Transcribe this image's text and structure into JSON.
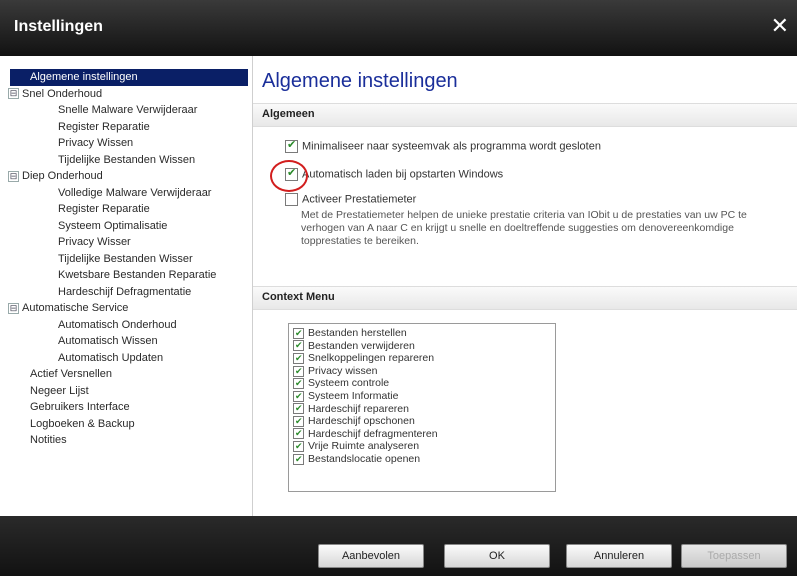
{
  "window": {
    "title": "Instellingen",
    "close_glyph": "✕"
  },
  "sidebar": {
    "items": [
      {
        "label": "Algemene instellingen",
        "level": 1,
        "selected": true
      },
      {
        "label": "Snel Onderhoud",
        "level": 0,
        "expander": "⊟"
      },
      {
        "label": "Snelle Malware Verwijderaar",
        "level": 2
      },
      {
        "label": "Register Reparatie",
        "level": 2
      },
      {
        "label": "Privacy Wissen",
        "level": 2
      },
      {
        "label": "Tijdelijke Bestanden Wissen",
        "level": 2
      },
      {
        "label": "Diep Onderhoud",
        "level": 0,
        "expander": "⊟"
      },
      {
        "label": "Volledige Malware Verwijderaar",
        "level": 2
      },
      {
        "label": "Register Reparatie",
        "level": 2
      },
      {
        "label": "Systeem Optimalisatie",
        "level": 2
      },
      {
        "label": "Privacy Wisser",
        "level": 2
      },
      {
        "label": "Tijdelijke Bestanden Wisser",
        "level": 2
      },
      {
        "label": "Kwetsbare Bestanden Reparatie",
        "level": 2
      },
      {
        "label": "Hardeschijf Defragmentatie",
        "level": 2
      },
      {
        "label": "Automatische Service",
        "level": 0,
        "expander": "⊟"
      },
      {
        "label": "Automatisch Onderhoud",
        "level": 2
      },
      {
        "label": "Automatisch Wissen",
        "level": 2
      },
      {
        "label": "Automatisch Updaten",
        "level": 2
      },
      {
        "label": "Actief Versnellen",
        "level": 1
      },
      {
        "label": "Negeer Lijst",
        "level": 1
      },
      {
        "label": "Gebruikers Interface",
        "level": 1
      },
      {
        "label": "Logboeken & Backup",
        "level": 1
      },
      {
        "label": "Notities",
        "level": 1
      }
    ]
  },
  "main": {
    "title": "Algemene instellingen",
    "general": {
      "heading": "Algemeen",
      "minimize_label": "Minimaliseer naar systeemvak als programma wordt gesloten",
      "minimize_checked": true,
      "autoload_label": "Automatisch laden bij opstarten Windows",
      "autoload_checked": true,
      "prestatie_label": "Activeer Prestatiemeter",
      "prestatie_checked": false,
      "prestatie_description": "Met de Prestatiemeter helpen de unieke prestatie criteria van IObit u de prestaties van uw PC te verhogen van A naar C en krijgt u snelle en doeltreffende suggesties om denovereenkomdige topprestaties te bereiken."
    },
    "context_menu": {
      "heading": "Context Menu",
      "items": [
        "Bestanden herstellen",
        "Bestanden verwijderen",
        "Snelkoppelingen repareren",
        "Privacy wissen",
        "Systeem controle",
        "Systeem Informatie",
        "Hardeschijf repareren",
        "Hardeschijf opschonen",
        "Hardeschijf defragmenteren",
        "Vrije Ruimte analyseren",
        "Bestandslocatie openen"
      ]
    }
  },
  "footer": {
    "buttons": {
      "recommended": "Aanbevolen",
      "ok": "OK",
      "cancel": "Annuleren",
      "apply": "Toepassen"
    }
  },
  "colors": {
    "title_blue": "#1a2e9a",
    "selection": "#0a1f66",
    "highlight_ring": "#d21e1e"
  }
}
